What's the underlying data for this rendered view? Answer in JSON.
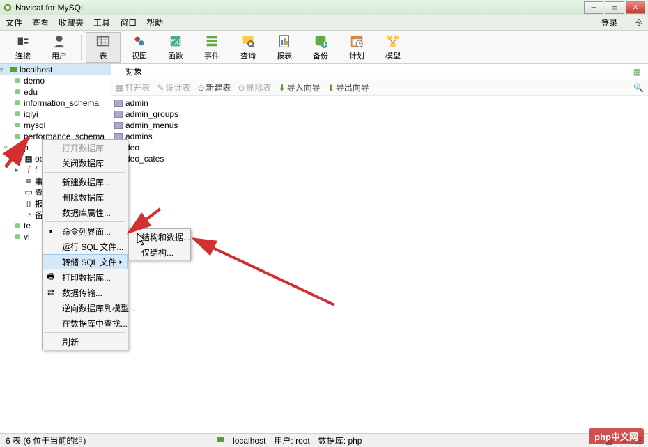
{
  "titlebar": {
    "title": "Navicat for MySQL"
  },
  "menubar": {
    "items": [
      "文件",
      "查看",
      "收藏夹",
      "工具",
      "窗口",
      "帮助"
    ],
    "login": "登录"
  },
  "toolbar": {
    "items": [
      {
        "label": "连接",
        "icon": "plug"
      },
      {
        "label": "用户",
        "icon": "user"
      },
      {
        "label": "表",
        "icon": "table",
        "active": true
      },
      {
        "label": "视图",
        "icon": "view"
      },
      {
        "label": "函数",
        "icon": "fx"
      },
      {
        "label": "事件",
        "icon": "event"
      },
      {
        "label": "查询",
        "icon": "query"
      },
      {
        "label": "报表",
        "icon": "report"
      },
      {
        "label": "备份",
        "icon": "backup"
      },
      {
        "label": "计划",
        "icon": "schedule"
      },
      {
        "label": "模型",
        "icon": "model"
      }
    ]
  },
  "tree": {
    "host": "localhost",
    "databases": [
      "demo",
      "edu",
      "information_schema",
      "iqiyi",
      "mysql",
      "performance_schema"
    ],
    "selected_db": "p",
    "sub_items": [
      "oo",
      "f",
      "事",
      "查",
      "报",
      "备",
      "te",
      "vi"
    ]
  },
  "tabs": {
    "current": "对象"
  },
  "actions": {
    "open": "打开表",
    "design": "设计表",
    "new": "新建表",
    "delete": "删除表",
    "import": "导入向导",
    "export": "导出向导"
  },
  "tables": [
    "admin",
    "admin_groups",
    "admin_menus",
    "admins",
    "deo",
    "deo_cates"
  ],
  "context_menu": {
    "items": [
      {
        "label": "打开数据库",
        "disabled": true
      },
      {
        "label": "关闭数据库"
      },
      {
        "sep": true
      },
      {
        "label": "新建数据库..."
      },
      {
        "label": "删除数据库"
      },
      {
        "label": "数据库属性..."
      },
      {
        "sep": true
      },
      {
        "label": "命令列界面...",
        "icon": "cmd"
      },
      {
        "label": "运行 SQL 文件..."
      },
      {
        "label": "转储 SQL 文件",
        "submenu": true,
        "hover": true
      },
      {
        "label": "打印数据库...",
        "icon": "print"
      },
      {
        "label": "数据传输...",
        "icon": "transfer"
      },
      {
        "label": "逆向数据库到模型..."
      },
      {
        "label": "在数据库中查找..."
      },
      {
        "sep": true
      },
      {
        "label": "刷新"
      }
    ]
  },
  "submenu": {
    "items": [
      {
        "label": "结构和数据..."
      },
      {
        "label": "仅结构..."
      }
    ]
  },
  "statusbar": {
    "left": "6 表 (6 位于当前的组)",
    "host": "localhost",
    "user": "用户: root",
    "db": "数据库: php"
  },
  "watermark": {
    "brand": "php",
    "text": "中文网"
  },
  "colors": {
    "green": "#5a9e3a",
    "blue_sel": "#d4e8f4",
    "red": "#d03030"
  }
}
